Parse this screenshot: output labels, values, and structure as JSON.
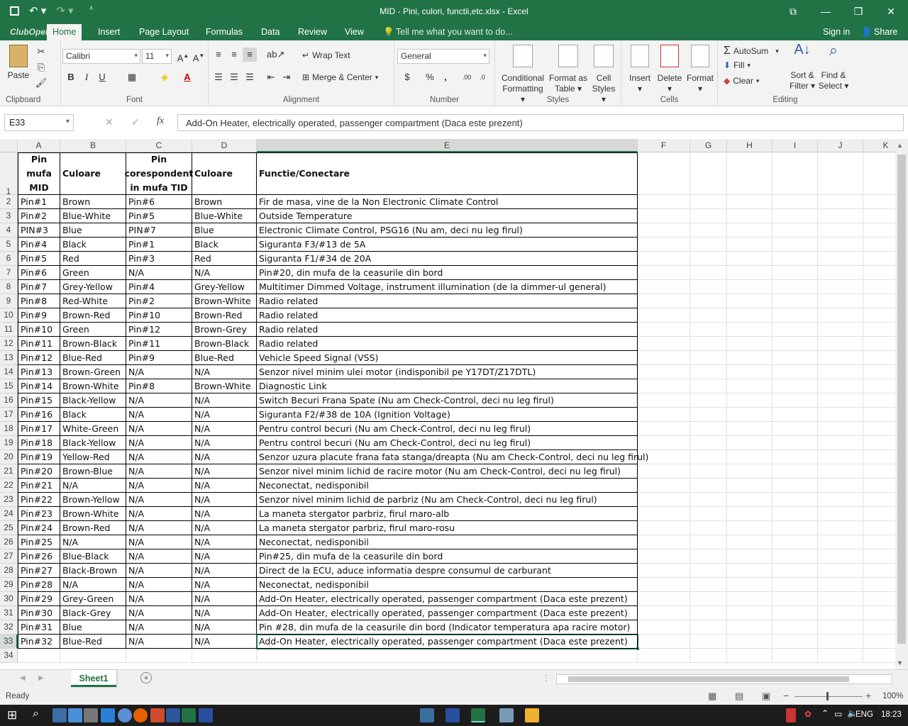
{
  "window": {
    "title": "MID - Pini, culori, functii,etc.xlsx - Excel"
  },
  "menu": {
    "logo": "ClubOpel.ro",
    "tabs": [
      "Home",
      "Insert",
      "Page Layout",
      "Formulas",
      "Data",
      "Review",
      "View"
    ],
    "tell_me": "Tell me what you want to do...",
    "sign_in": "Sign in",
    "share": "Share"
  },
  "ribbon": {
    "clipboard": {
      "label": "Clipboard",
      "paste": "Paste"
    },
    "font": {
      "label": "Font",
      "name": "Calibri",
      "size": "11",
      "bold": "B",
      "italic": "I",
      "underline": "U"
    },
    "alignment": {
      "label": "Alignment",
      "wrap": "Wrap Text",
      "merge": "Merge & Center"
    },
    "number": {
      "label": "Number",
      "format": "General",
      "currency": "$",
      "percent": "%",
      "comma": ","
    },
    "styles": {
      "label": "Styles",
      "cond1": "Conditional",
      "cond2": "Formatting",
      "fmt1": "Format as",
      "fmt2": "Table",
      "cell1": "Cell",
      "cell2": "Styles"
    },
    "cells": {
      "label": "Cells",
      "insert": "Insert",
      "delete": "Delete",
      "format": "Format"
    },
    "editing": {
      "label": "Editing",
      "autosum": "AutoSum",
      "fill": "Fill",
      "clear": "Clear",
      "sort1": "Sort &",
      "sort2": "Filter",
      "find1": "Find &",
      "find2": "Select"
    }
  },
  "formula_bar": {
    "name_box": "E33",
    "fx": "fx",
    "content": "Add-On Heater, electrically operated, passenger compartment (Daca este prezent)"
  },
  "columns": [
    "A",
    "B",
    "C",
    "D",
    "E",
    "F",
    "G",
    "H",
    "I",
    "J",
    "K"
  ],
  "headers": [
    "Pin mufa MID",
    "Culoare",
    "Pin corespondent in mufa TID",
    "Culoare",
    "Functie/Conectare"
  ],
  "rows": [
    [
      "Pin#1",
      "Brown",
      "Pin#6",
      "Brown",
      "Fir de masa, vine de la Non Electronic Climate Control"
    ],
    [
      "Pin#2",
      "Blue-White",
      "Pin#5",
      "Blue-White",
      "Outside Temperature"
    ],
    [
      "PIN#3",
      "Blue",
      "PIN#7",
      "Blue",
      "Electronic Climate Control, PSG16 (Nu am, deci nu leg firul)"
    ],
    [
      "Pin#4",
      "Black",
      "Pin#1",
      "Black",
      "Siguranta F3/#13 de 5A"
    ],
    [
      "Pin#5",
      "Red",
      "Pin#3",
      "Red",
      "Siguranta F1/#34 de 20A"
    ],
    [
      "Pin#6",
      "Green",
      "N/A",
      "N/A",
      "Pin#20, din mufa de la ceasurile din bord"
    ],
    [
      "Pin#7",
      "Grey-Yellow",
      "Pin#4",
      "Grey-Yellow",
      "Multitimer Dimmed Voltage, instrument illumination (de la dimmer-ul general)"
    ],
    [
      "Pin#8",
      "Red-White",
      "Pin#2",
      "Brown-White",
      "Radio related"
    ],
    [
      "Pin#9",
      "Brown-Red",
      "Pin#10",
      "Brown-Red",
      "Radio related"
    ],
    [
      "Pin#10",
      "Green",
      "Pin#12",
      "Brown-Grey",
      "Radio related"
    ],
    [
      "Pin#11",
      "Brown-Black",
      "Pin#11",
      "Brown-Black",
      "Radio related"
    ],
    [
      "Pin#12",
      "Blue-Red",
      "Pin#9",
      "Blue-Red",
      "Vehicle Speed Signal (VSS)"
    ],
    [
      "Pin#13",
      "Brown-Green",
      "N/A",
      "N/A",
      "Senzor nivel minim ulei motor (indisponibil pe Y17DT/Z17DTL)"
    ],
    [
      "Pin#14",
      "Brown-White",
      "Pin#8",
      "Brown-White",
      "Diagnostic Link"
    ],
    [
      "Pin#15",
      "Black-Yellow",
      "N/A",
      "N/A",
      "Switch Becuri Frana Spate (Nu am Check-Control, deci nu leg firul)"
    ],
    [
      "Pin#16",
      "Black",
      "N/A",
      "N/A",
      "Siguranta F2/#38 de 10A (Ignition Voltage)"
    ],
    [
      "Pin#17",
      "White-Green",
      "N/A",
      "N/A",
      "Pentru control becuri (Nu am Check-Control, deci nu leg firul)"
    ],
    [
      "Pin#18",
      "Black-Yellow",
      "N/A",
      "N/A",
      "Pentru control becuri (Nu am Check-Control, deci nu leg firul)"
    ],
    [
      "Pin#19",
      "Yellow-Red",
      "N/A",
      "N/A",
      "Senzor uzura placute frana fata stanga/dreapta (Nu am Check-Control, deci nu leg firul)"
    ],
    [
      "Pin#20",
      "Brown-Blue",
      "N/A",
      "N/A",
      "Senzor nivel minim lichid de racire motor (Nu am Check-Control, deci nu leg firul)"
    ],
    [
      "Pin#21",
      "N/A",
      "N/A",
      "N/A",
      "Neconectat, nedisponibil"
    ],
    [
      "Pin#22",
      "Brown-Yellow",
      "N/A",
      "N/A",
      "Senzor nivel minim lichid de parbriz (Nu am Check-Control, deci nu leg firul)"
    ],
    [
      "Pin#23",
      "Brown-White",
      "N/A",
      "N/A",
      "La maneta stergator parbriz, firul maro-alb"
    ],
    [
      "Pin#24",
      "Brown-Red",
      "N/A",
      "N/A",
      "La maneta stergator parbriz, firul maro-rosu"
    ],
    [
      "Pin#25",
      "N/A",
      "N/A",
      "N/A",
      "Neconectat, nedisponibil"
    ],
    [
      "Pin#26",
      "Blue-Black",
      "N/A",
      "N/A",
      "Pin#25, din mufa de la ceasurile din bord"
    ],
    [
      "Pin#27",
      "Black-Brown",
      "N/A",
      "N/A",
      "Direct de la ECU, aduce informatia despre consumul de carburant"
    ],
    [
      "Pin#28",
      "N/A",
      "N/A",
      "N/A",
      "Neconectat, nedisponibil"
    ],
    [
      "Pin#29",
      "Grey-Green",
      "N/A",
      "N/A",
      "Add-On Heater, electrically operated, passenger compartment (Daca este prezent)"
    ],
    [
      "Pin#30",
      "Black-Grey",
      "N/A",
      "N/A",
      "Add-On Heater, electrically operated, passenger compartment (Daca este prezent)"
    ],
    [
      "Pin#31",
      "Blue",
      "N/A",
      "N/A",
      "Pin #28, din mufa de la ceasurile din bord (Indicator temperatura apa racire motor)"
    ],
    [
      "Pin#32",
      "Blue-Red",
      "N/A",
      "N/A",
      "Add-On Heater, electrically operated, passenger compartment (Daca este prezent)"
    ]
  ],
  "sheet": {
    "tab": "Sheet1",
    "add": "+"
  },
  "status": {
    "ready": "Ready",
    "zoom": "100%"
  },
  "taskbar": {
    "lang": "ENG",
    "time": "18:23"
  },
  "colors": {
    "accent": "#217346"
  }
}
